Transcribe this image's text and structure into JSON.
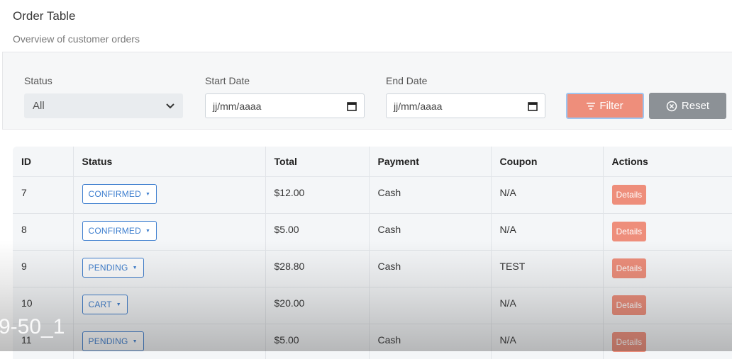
{
  "header": {
    "title": "Order Table",
    "subtitle": "Overview of customer orders"
  },
  "filters": {
    "status_label": "Status",
    "status_value": "All",
    "start_date_label": "Start Date",
    "start_date_placeholder": "jj/mm/aaaa",
    "end_date_label": "End Date",
    "end_date_placeholder": "jj/mm/aaaa",
    "filter_label": "Filter",
    "reset_label": "Reset"
  },
  "table": {
    "columns": [
      "ID",
      "Status",
      "Total",
      "Payment",
      "Coupon",
      "Actions"
    ],
    "rows": [
      {
        "id": "7",
        "status": "CONFIRMED",
        "total": "$12.00",
        "payment": "Cash",
        "coupon": "N/A",
        "action": "Details"
      },
      {
        "id": "8",
        "status": "CONFIRMED",
        "total": "$5.00",
        "payment": "Cash",
        "coupon": "N/A",
        "action": "Details"
      },
      {
        "id": "9",
        "status": "PENDING",
        "total": "$28.80",
        "payment": "Cash",
        "coupon": "TEST",
        "action": "Details"
      },
      {
        "id": "10",
        "status": "CART",
        "total": "$20.00",
        "payment": "",
        "coupon": "N/A",
        "action": "Details"
      },
      {
        "id": "11",
        "status": "PENDING",
        "total": "$5.00",
        "payment": "Cash",
        "coupon": "N/A",
        "action": "Details"
      }
    ]
  },
  "watermark": "9-50_1",
  "colors": {
    "accent": "#ee8e7b",
    "status_blue": "#3f7fcf",
    "reset_gray": "#8c9196"
  }
}
